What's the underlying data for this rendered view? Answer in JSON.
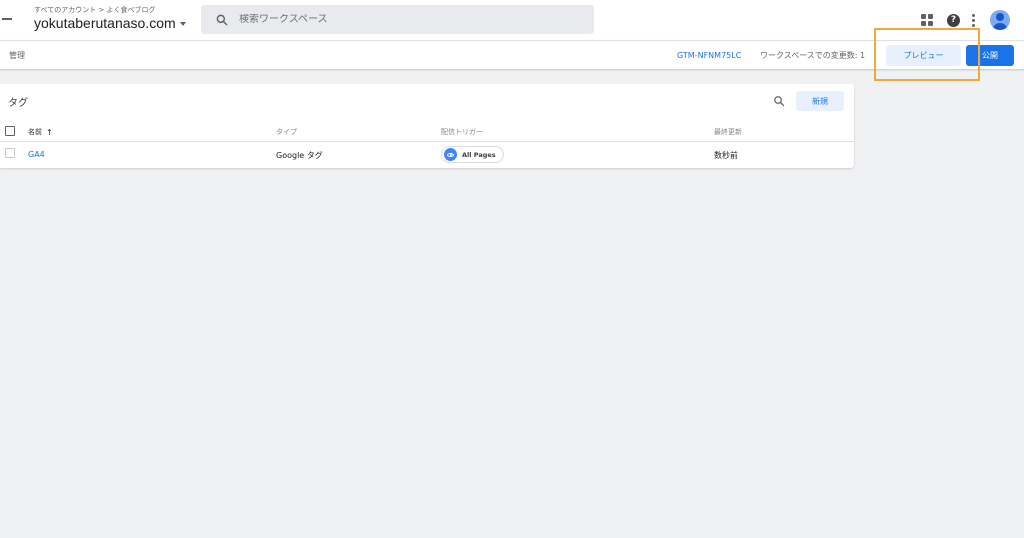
{
  "header": {
    "breadcrumb": "すべてのアカウント > よく食べブログ",
    "account_name": "yokutaberutanaso.com",
    "search_placeholder": "検索ワークスペース"
  },
  "toolbar": {
    "admin_label": "管理",
    "container_id": "GTM-NFNM75LC",
    "workspace_changes": "ワークスペースでの変更数: 1",
    "preview_label": "プレビュー",
    "publish_label": "公開"
  },
  "tags_panel": {
    "title": "タグ",
    "new_label": "新規",
    "columns": {
      "name": "名前",
      "type": "タイプ",
      "trigger": "配信トリガー",
      "updated": "最終更新"
    },
    "rows": [
      {
        "name": "GA4",
        "type": "Google タグ",
        "trigger": "All Pages",
        "updated": "数秒前"
      }
    ]
  },
  "icons": {
    "menu": "menu-icon",
    "search": "search-icon",
    "apps": "apps-icon",
    "help": "help-icon",
    "more": "more-vert-icon",
    "avatar": "account-avatar-icon",
    "sort": "arrow-up-icon",
    "trigger": "eye-icon"
  },
  "colors": {
    "accent": "#1a73e8",
    "accent_light": "#e8f0fe",
    "highlight": "#f2a93b",
    "background": "#f0f1f3"
  }
}
